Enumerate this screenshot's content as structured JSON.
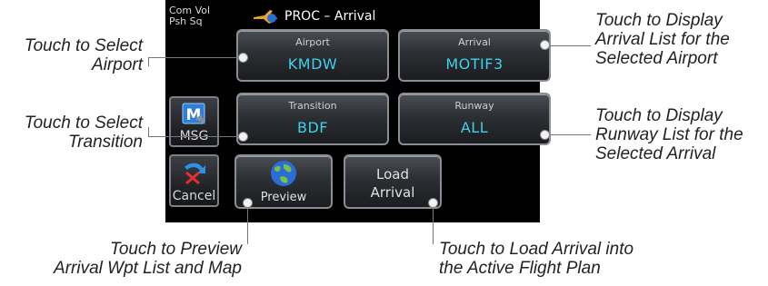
{
  "screen": {
    "com_vol_label": [
      "Com Vol",
      "Psh Sq"
    ],
    "title": "PROC – Arrival",
    "airport": {
      "label": "Airport",
      "value": "KMDW"
    },
    "arrival": {
      "label": "Arrival",
      "value": "MOTIF3"
    },
    "transition": {
      "label": "Transition",
      "value": "BDF"
    },
    "runway": {
      "label": "Runway",
      "value": "ALL"
    },
    "msg_label": "MSG",
    "cancel_label": "Cancel",
    "preview_label": "Preview",
    "load_arrival_label": [
      "Load",
      "Arrival"
    ]
  },
  "callouts": {
    "select_airport": [
      "Touch to Select",
      "Airport"
    ],
    "select_transition": [
      "Touch to Select",
      "Transition"
    ],
    "display_arrival_list": [
      "Touch to Display",
      "Arrival List for the",
      "Selected Airport"
    ],
    "display_runway_list": [
      "Touch to Display",
      "Runway List for the",
      "Selected Arrival"
    ],
    "preview": [
      "Touch to Preview",
      "Arrival Wpt List and Map"
    ],
    "load_arrival": [
      "Touch to Load Arrival into",
      "the Active Flight Plan"
    ]
  },
  "colors": {
    "screen_bg": "#000000",
    "value_text": "#3fd0ea",
    "label_text": "#d0d0d0",
    "callout_text": "#222222"
  }
}
